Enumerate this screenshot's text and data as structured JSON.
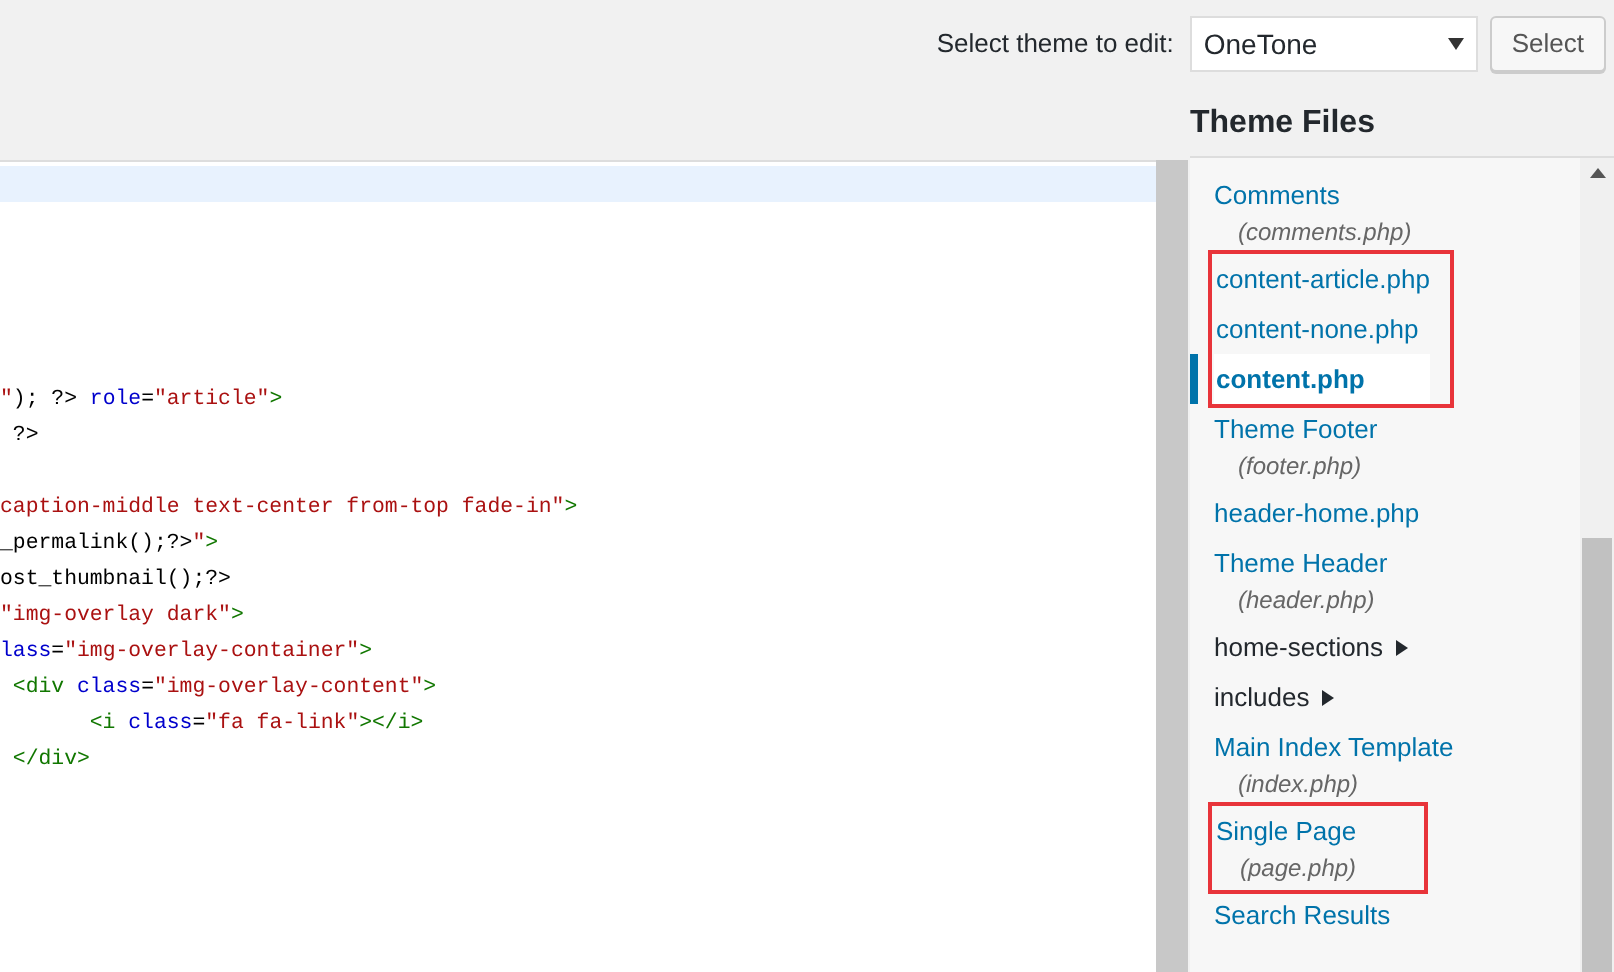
{
  "theme_picker": {
    "label": "Select theme to edit:",
    "value": "OneTone",
    "button": "Select"
  },
  "editor": {
    "lines": [
      {
        "kind": "current"
      },
      {
        "kind": "blank"
      },
      {
        "kind": "blank"
      },
      {
        "kind": "blank"
      },
      {
        "kind": "blank"
      },
      {
        "kind": "blank"
      },
      {
        "kind": "code",
        "tokens": [
          {
            "kind": "string",
            "text": "\""
          },
          {
            "kind": "plain",
            "text": "); ?> "
          },
          {
            "kind": "attr",
            "text": "role"
          },
          {
            "kind": "plain",
            "text": "="
          },
          {
            "kind": "string",
            "text": "\"article\""
          },
          {
            "kind": "tag",
            "text": ">"
          }
        ]
      },
      {
        "kind": "code",
        "tokens": [
          {
            "kind": "plain",
            "text": " ?>"
          }
        ]
      },
      {
        "kind": "blank"
      },
      {
        "kind": "code",
        "tokens": [
          {
            "kind": "string",
            "text": "caption-middle text-center from-top fade-in\""
          },
          {
            "kind": "tag",
            "text": ">"
          }
        ]
      },
      {
        "kind": "code",
        "tokens": [
          {
            "kind": "plain",
            "text": "_permalink();?>"
          },
          {
            "kind": "string",
            "text": "\""
          },
          {
            "kind": "tag",
            "text": ">"
          }
        ]
      },
      {
        "kind": "code",
        "tokens": [
          {
            "kind": "plain",
            "text": "ost_thumbnail();?>"
          }
        ]
      },
      {
        "kind": "code",
        "tokens": [
          {
            "kind": "string",
            "text": "\"img-overlay dark\""
          },
          {
            "kind": "tag",
            "text": ">"
          }
        ]
      },
      {
        "kind": "code",
        "tokens": [
          {
            "kind": "attr",
            "text": "lass"
          },
          {
            "kind": "plain",
            "text": "="
          },
          {
            "kind": "string",
            "text": "\"img-overlay-container\""
          },
          {
            "kind": "tag",
            "text": ">"
          }
        ]
      },
      {
        "kind": "code",
        "tokens": [
          {
            "kind": "tag",
            "text": " <div "
          },
          {
            "kind": "attr",
            "text": "class"
          },
          {
            "kind": "plain",
            "text": "="
          },
          {
            "kind": "string",
            "text": "\"img-overlay-content\""
          },
          {
            "kind": "tag",
            "text": ">"
          }
        ]
      },
      {
        "kind": "code",
        "tokens": [
          {
            "kind": "tag",
            "text": "       <i "
          },
          {
            "kind": "attr",
            "text": "class"
          },
          {
            "kind": "plain",
            "text": "="
          },
          {
            "kind": "string",
            "text": "\"fa fa-link\""
          },
          {
            "kind": "tag",
            "text": "></i>"
          }
        ]
      },
      {
        "kind": "code",
        "tokens": [
          {
            "kind": "tag",
            "text": " </div>"
          }
        ]
      }
    ]
  },
  "theme_files": {
    "title": "Theme Files",
    "items": [
      {
        "kind": "file",
        "label": "Comments",
        "file": "(comments.php)",
        "selected": false,
        "boxed": false
      },
      {
        "kind": "file",
        "label": "content-article.php",
        "selected": false,
        "boxed": true
      },
      {
        "kind": "file",
        "label": "content-none.php",
        "selected": false,
        "boxed": true
      },
      {
        "kind": "file",
        "label": "content.php",
        "selected": true,
        "boxed": true
      },
      {
        "kind": "file",
        "label": "Theme Footer",
        "file": "(footer.php)",
        "selected": false,
        "boxed": false
      },
      {
        "kind": "file",
        "label": "header-home.php",
        "selected": false,
        "boxed": false
      },
      {
        "kind": "file",
        "label": "Theme Header",
        "file": "(header.php)",
        "selected": false,
        "boxed": false
      },
      {
        "kind": "folder",
        "label": "home-sections",
        "selected": false,
        "boxed": false
      },
      {
        "kind": "folder",
        "label": "includes",
        "selected": false,
        "boxed": false
      },
      {
        "kind": "file",
        "label": "Main Index Template",
        "file": "(index.php)",
        "selected": false,
        "boxed": false
      },
      {
        "kind": "file",
        "label": "Single Page",
        "file": "(page.php)",
        "selected": false,
        "boxed": true
      },
      {
        "kind": "file",
        "label": "Search Results",
        "selected": false,
        "boxed": false
      }
    ]
  }
}
